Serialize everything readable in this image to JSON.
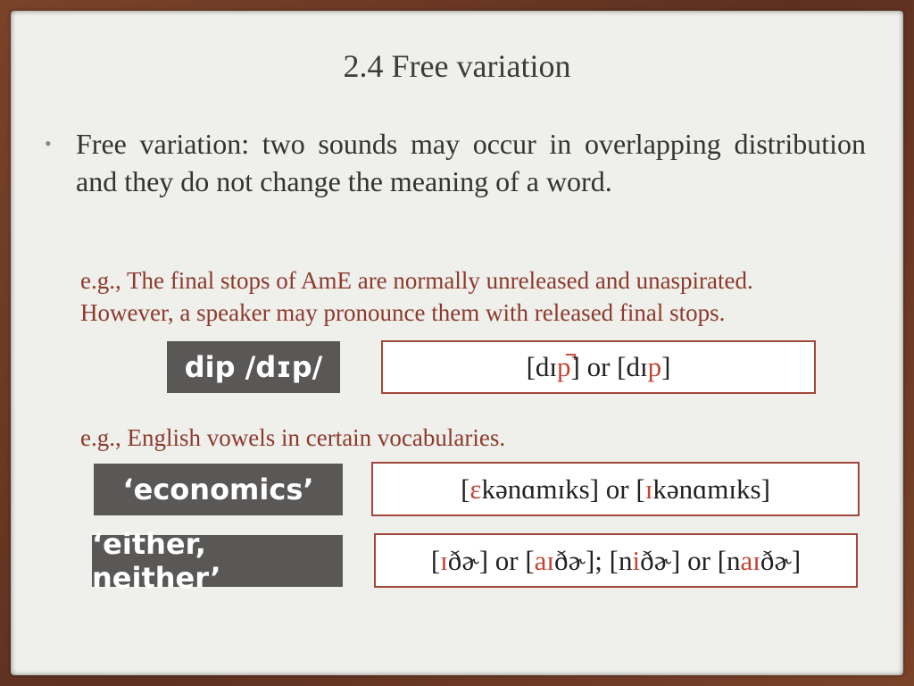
{
  "slide": {
    "title": "2.4 Free variation",
    "bullet_marker": "•",
    "bullet_text": "Free variation: two sounds may occur in overlapping distribution and they do not change the meaning of a word.",
    "example1": {
      "line1": "e.g., The final stops of AmE are normally unreleased and unaspirated.",
      "line2": "However, a speaker may pronounce them with released final stops."
    },
    "example2": "e.g., English vowels in certain vocabularies.",
    "rows": [
      {
        "label": "dip /dɪp/",
        "segments": [
          {
            "text": "[dɪ",
            "highlight": false
          },
          {
            "text": "p̚",
            "highlight": true
          },
          {
            "text": "] or [dɪ",
            "highlight": false
          },
          {
            "text": "p",
            "highlight": true
          },
          {
            "text": "]",
            "highlight": false
          }
        ]
      },
      {
        "label": "‘economics’",
        "segments": [
          {
            "text": "[",
            "highlight": false
          },
          {
            "text": "ɛ",
            "highlight": true
          },
          {
            "text": "kənɑmɪks] or [",
            "highlight": false
          },
          {
            "text": "ɪ",
            "highlight": true
          },
          {
            "text": "kənɑmɪks]",
            "highlight": false
          }
        ]
      },
      {
        "label": "‘either, neither’",
        "segments": [
          {
            "text": "[",
            "highlight": false
          },
          {
            "text": "ɪ",
            "highlight": true
          },
          {
            "text": "ðɚ] or [",
            "highlight": false
          },
          {
            "text": "aɪ",
            "highlight": true
          },
          {
            "text": "ðɚ]; [n",
            "highlight": false
          },
          {
            "text": "i",
            "highlight": true
          },
          {
            "text": "ðɚ] or [n",
            "highlight": false
          },
          {
            "text": "aɪ",
            "highlight": true
          },
          {
            "text": "ðɚ]",
            "highlight": false
          }
        ]
      }
    ]
  },
  "colors": {
    "frame": "#6b3a26",
    "slide_bg": "#efefec",
    "example_text": "#8c3a2c",
    "label_bg": "#5a5857",
    "highlight": "#c24433",
    "box_border": "#a0463a"
  }
}
